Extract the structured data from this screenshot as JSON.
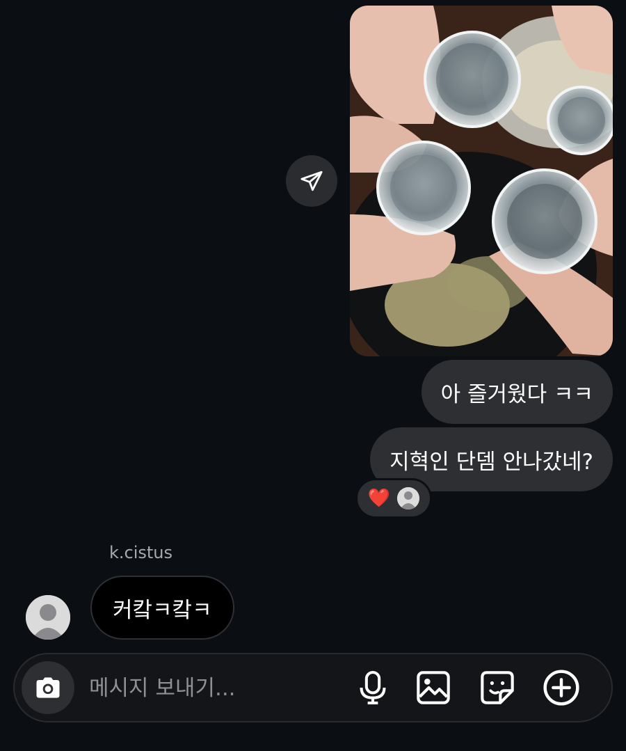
{
  "messages": {
    "outgoing": [
      {
        "text": "아 즐거웠다 ㅋㅋ"
      },
      {
        "text": "지혁인 단뎀 안나갔네?"
      }
    ],
    "reaction": {
      "emoji": "❤️"
    },
    "incoming": {
      "sender": "k.cistus",
      "text": "커캌ㅋ캌ㅋ"
    }
  },
  "composer": {
    "placeholder": "메시지 보내기..."
  },
  "icons": {
    "share": "paper-plane-icon",
    "camera": "camera-icon",
    "mic": "microphone-icon",
    "gallery": "image-icon",
    "sticker": "sticker-icon",
    "add": "plus-circle-icon"
  },
  "colors": {
    "background": "#0b0f14",
    "bubble_outgoing": "#2e2f32",
    "bubble_incoming": "#000000",
    "placeholder": "#8f9094"
  }
}
